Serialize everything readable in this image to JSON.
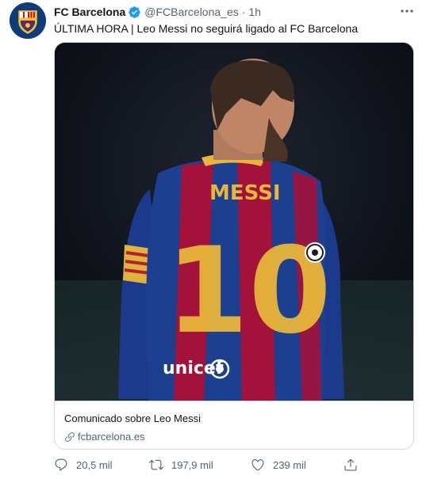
{
  "account": {
    "display_name": "FC Barcelona",
    "handle": "@FCBarcelona_es",
    "separator": "·",
    "time": "1h",
    "avatar_icon": "fc-barcelona-crest-icon"
  },
  "tweet": {
    "text": "ÚLTIMA HORA | Leo Messi no seguirá ligado al FC Barcelona"
  },
  "card": {
    "title": "Comunicado sobre Leo Messi",
    "domain": "fcbarcelona.es",
    "image_description_icons": [
      "messi-jersey-photo"
    ],
    "jersey_name": "MESSI",
    "jersey_number": "10",
    "sponsor": "unicef"
  },
  "actions": {
    "replies": "20,5 mil",
    "retweets": "197,9 mil",
    "likes": "239 mil"
  },
  "colors": {
    "verified": "#1d9bf0",
    "secondary_text": "#536471",
    "border": "#cfd9de",
    "barca_blue": "#1d3f8f",
    "barca_red": "#a3123a",
    "gold": "#e8b63a"
  }
}
